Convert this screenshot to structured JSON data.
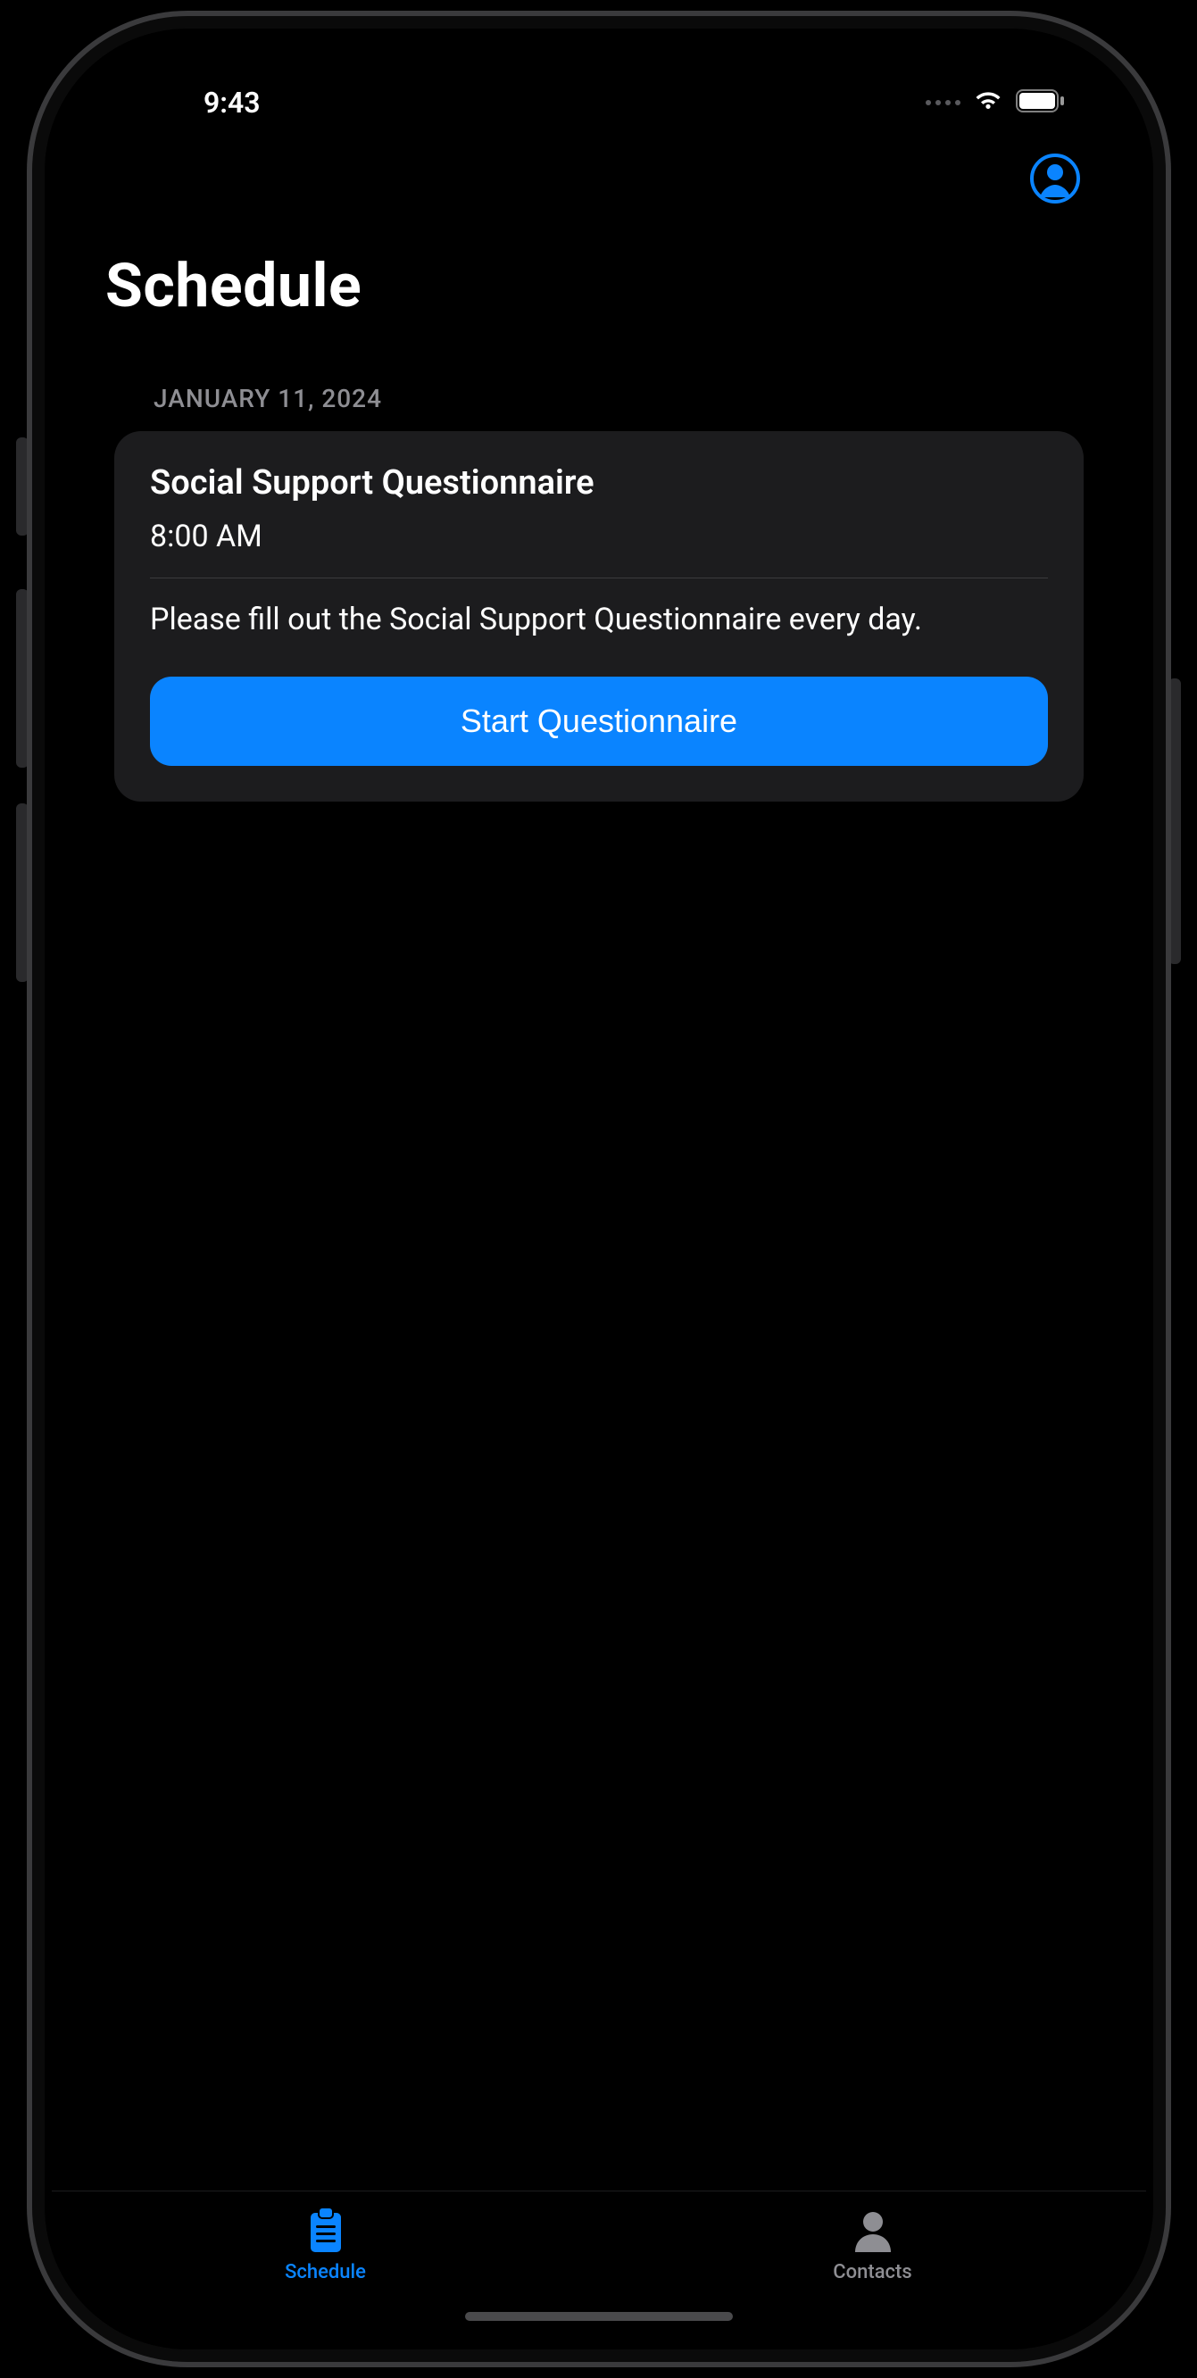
{
  "status_bar": {
    "time": "9:43"
  },
  "header": {
    "title": "Schedule"
  },
  "schedule": {
    "date_label": "JANUARY 11, 2024",
    "items": [
      {
        "title": "Social Support Questionnaire",
        "time": "8:00 AM",
        "description": "Please fill out the Social Support Questionnaire every day.",
        "action_label": "Start Questionnaire"
      }
    ]
  },
  "tabs": [
    {
      "label": "Schedule",
      "icon": "clipboard-icon",
      "active": true
    },
    {
      "label": "Contacts",
      "icon": "person-icon",
      "active": false
    }
  ],
  "colors": {
    "accent": "#0a84ff",
    "card_bg": "#1c1c1e",
    "secondary_text": "#8e8e93"
  }
}
